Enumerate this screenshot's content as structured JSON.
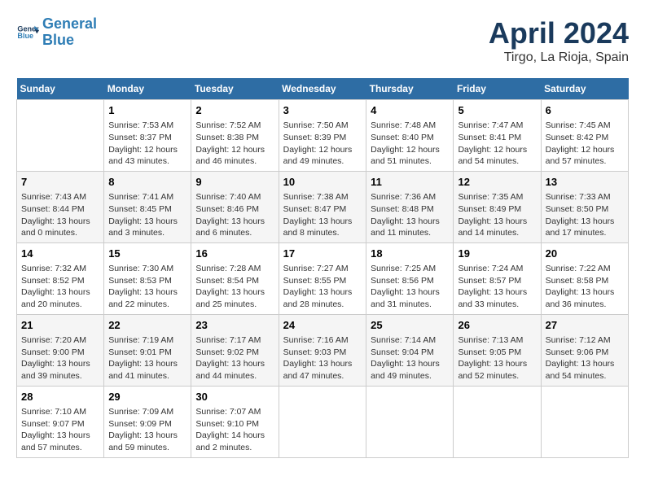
{
  "header": {
    "logo_line1": "General",
    "logo_line2": "Blue",
    "month": "April 2024",
    "location": "Tirgo, La Rioja, Spain"
  },
  "days_of_week": [
    "Sunday",
    "Monday",
    "Tuesday",
    "Wednesday",
    "Thursday",
    "Friday",
    "Saturday"
  ],
  "weeks": [
    [
      {
        "day": "",
        "info": ""
      },
      {
        "day": "1",
        "info": "Sunrise: 7:53 AM\nSunset: 8:37 PM\nDaylight: 12 hours\nand 43 minutes."
      },
      {
        "day": "2",
        "info": "Sunrise: 7:52 AM\nSunset: 8:38 PM\nDaylight: 12 hours\nand 46 minutes."
      },
      {
        "day": "3",
        "info": "Sunrise: 7:50 AM\nSunset: 8:39 PM\nDaylight: 12 hours\nand 49 minutes."
      },
      {
        "day": "4",
        "info": "Sunrise: 7:48 AM\nSunset: 8:40 PM\nDaylight: 12 hours\nand 51 minutes."
      },
      {
        "day": "5",
        "info": "Sunrise: 7:47 AM\nSunset: 8:41 PM\nDaylight: 12 hours\nand 54 minutes."
      },
      {
        "day": "6",
        "info": "Sunrise: 7:45 AM\nSunset: 8:42 PM\nDaylight: 12 hours\nand 57 minutes."
      }
    ],
    [
      {
        "day": "7",
        "info": "Sunrise: 7:43 AM\nSunset: 8:44 PM\nDaylight: 13 hours\nand 0 minutes."
      },
      {
        "day": "8",
        "info": "Sunrise: 7:41 AM\nSunset: 8:45 PM\nDaylight: 13 hours\nand 3 minutes."
      },
      {
        "day": "9",
        "info": "Sunrise: 7:40 AM\nSunset: 8:46 PM\nDaylight: 13 hours\nand 6 minutes."
      },
      {
        "day": "10",
        "info": "Sunrise: 7:38 AM\nSunset: 8:47 PM\nDaylight: 13 hours\nand 8 minutes."
      },
      {
        "day": "11",
        "info": "Sunrise: 7:36 AM\nSunset: 8:48 PM\nDaylight: 13 hours\nand 11 minutes."
      },
      {
        "day": "12",
        "info": "Sunrise: 7:35 AM\nSunset: 8:49 PM\nDaylight: 13 hours\nand 14 minutes."
      },
      {
        "day": "13",
        "info": "Sunrise: 7:33 AM\nSunset: 8:50 PM\nDaylight: 13 hours\nand 17 minutes."
      }
    ],
    [
      {
        "day": "14",
        "info": "Sunrise: 7:32 AM\nSunset: 8:52 PM\nDaylight: 13 hours\nand 20 minutes."
      },
      {
        "day": "15",
        "info": "Sunrise: 7:30 AM\nSunset: 8:53 PM\nDaylight: 13 hours\nand 22 minutes."
      },
      {
        "day": "16",
        "info": "Sunrise: 7:28 AM\nSunset: 8:54 PM\nDaylight: 13 hours\nand 25 minutes."
      },
      {
        "day": "17",
        "info": "Sunrise: 7:27 AM\nSunset: 8:55 PM\nDaylight: 13 hours\nand 28 minutes."
      },
      {
        "day": "18",
        "info": "Sunrise: 7:25 AM\nSunset: 8:56 PM\nDaylight: 13 hours\nand 31 minutes."
      },
      {
        "day": "19",
        "info": "Sunrise: 7:24 AM\nSunset: 8:57 PM\nDaylight: 13 hours\nand 33 minutes."
      },
      {
        "day": "20",
        "info": "Sunrise: 7:22 AM\nSunset: 8:58 PM\nDaylight: 13 hours\nand 36 minutes."
      }
    ],
    [
      {
        "day": "21",
        "info": "Sunrise: 7:20 AM\nSunset: 9:00 PM\nDaylight: 13 hours\nand 39 minutes."
      },
      {
        "day": "22",
        "info": "Sunrise: 7:19 AM\nSunset: 9:01 PM\nDaylight: 13 hours\nand 41 minutes."
      },
      {
        "day": "23",
        "info": "Sunrise: 7:17 AM\nSunset: 9:02 PM\nDaylight: 13 hours\nand 44 minutes."
      },
      {
        "day": "24",
        "info": "Sunrise: 7:16 AM\nSunset: 9:03 PM\nDaylight: 13 hours\nand 47 minutes."
      },
      {
        "day": "25",
        "info": "Sunrise: 7:14 AM\nSunset: 9:04 PM\nDaylight: 13 hours\nand 49 minutes."
      },
      {
        "day": "26",
        "info": "Sunrise: 7:13 AM\nSunset: 9:05 PM\nDaylight: 13 hours\nand 52 minutes."
      },
      {
        "day": "27",
        "info": "Sunrise: 7:12 AM\nSunset: 9:06 PM\nDaylight: 13 hours\nand 54 minutes."
      }
    ],
    [
      {
        "day": "28",
        "info": "Sunrise: 7:10 AM\nSunset: 9:07 PM\nDaylight: 13 hours\nand 57 minutes."
      },
      {
        "day": "29",
        "info": "Sunrise: 7:09 AM\nSunset: 9:09 PM\nDaylight: 13 hours\nand 59 minutes."
      },
      {
        "day": "30",
        "info": "Sunrise: 7:07 AM\nSunset: 9:10 PM\nDaylight: 14 hours\nand 2 minutes."
      },
      {
        "day": "",
        "info": ""
      },
      {
        "day": "",
        "info": ""
      },
      {
        "day": "",
        "info": ""
      },
      {
        "day": "",
        "info": ""
      }
    ]
  ]
}
